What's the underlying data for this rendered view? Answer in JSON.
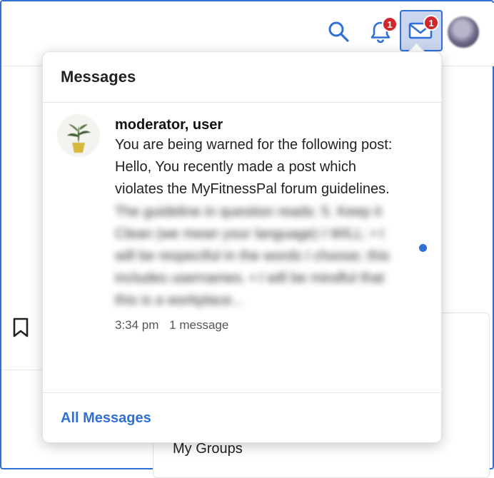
{
  "header": {
    "notifications_count": "1",
    "messages_count": "1",
    "icons": [
      "search-icon",
      "bell-icon",
      "envelope-icon",
      "user-avatar"
    ],
    "accent_color": "#2f6fd8",
    "badge_color": "#d0262d"
  },
  "messages_panel": {
    "title": "Messages",
    "items": [
      {
        "sender": "moderator, user",
        "preview_visible": "You are being warned for the following post: Hello, You recently made a post which violates the MyFitnessPal forum guidelines.",
        "preview_blurred": "The guideline in question reads: 5. Keep it Clean (we mean your language) I WILL: • I will be respectful in the words I choose; this includes usernames. • I will be mindful that this is a workplace...",
        "time": "3:34 pm",
        "count": "1 message",
        "unread": true
      }
    ],
    "footer_link": "All Messages"
  },
  "background": {
    "my_groups_label": "My Groups"
  }
}
